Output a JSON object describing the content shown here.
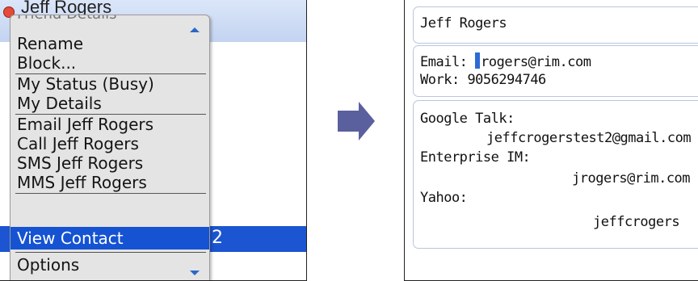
{
  "left": {
    "header_name": "Jeff Rogers",
    "menu_title": "Friend Details",
    "menu_items": [
      {
        "label": "Rename"
      },
      {
        "label": "Block..."
      },
      {
        "label": "My Status (Busy)"
      },
      {
        "label": "My Details"
      },
      {
        "label": "Email Jeff Rogers"
      },
      {
        "label": "Call Jeff Rogers"
      },
      {
        "label": "SMS Jeff Rogers"
      },
      {
        "label": "MMS Jeff Rogers"
      },
      {
        "label": "View Contact"
      },
      {
        "label": "Options"
      }
    ],
    "selected_index": 8,
    "background_partial_text": "2"
  },
  "right": {
    "name": "Jeff Rogers",
    "email_label": "Email:",
    "email_value": "rogers@rim.com",
    "work_label": "Work:",
    "work_value": "9056294746",
    "im_accounts": [
      {
        "service": "Google Talk:",
        "value": "jeffcrogerstest2@gmail.com"
      },
      {
        "service": "Enterprise IM:",
        "value": "jrogers@rim.com"
      },
      {
        "service": "Yahoo:",
        "value": "jeffcrogers"
      }
    ]
  },
  "colors": {
    "selection": "#1553d3",
    "arrow": "#5a5f9e",
    "status_busy": "#e34a3a"
  },
  "icons": [
    "status-busy-icon",
    "scroll-up-icon",
    "scroll-down-icon",
    "arrow-right-icon"
  ]
}
